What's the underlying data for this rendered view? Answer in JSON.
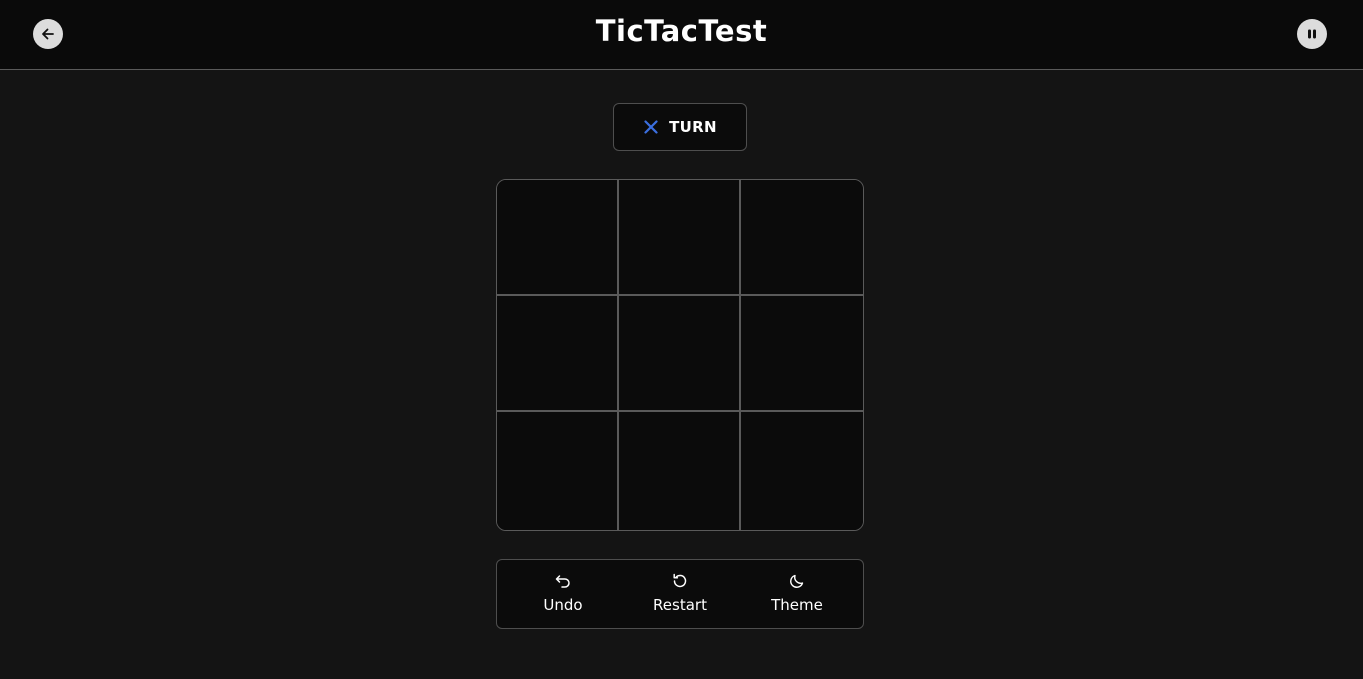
{
  "header": {
    "title": "TicTacTest",
    "back_icon": "arrow-left-icon",
    "pause_icon": "pause-icon"
  },
  "turn": {
    "player_icon": "x-icon",
    "player_color": "#3b6fe0",
    "label": "TURN"
  },
  "board": {
    "rows": 3,
    "cols": 3,
    "cells": [
      "",
      "",
      "",
      "",
      "",
      "",
      "",
      "",
      ""
    ]
  },
  "controls": {
    "undo": {
      "label": "Undo",
      "icon": "undo-icon"
    },
    "restart": {
      "label": "Restart",
      "icon": "restart-icon"
    },
    "theme": {
      "label": "Theme",
      "icon": "moon-icon"
    }
  },
  "colors": {
    "background": "#141414",
    "header": "#0a0a0a",
    "grid_line": "#5a5a5a",
    "cell": "#0b0b0b"
  }
}
